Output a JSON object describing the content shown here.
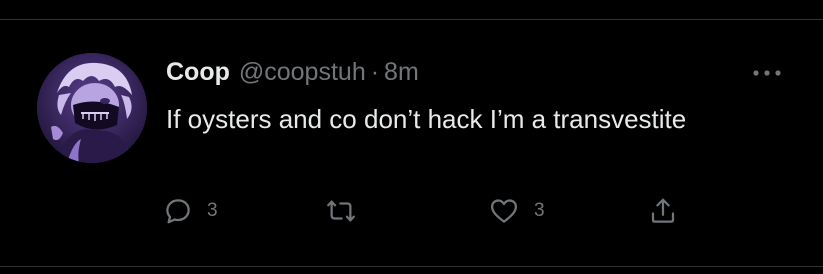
{
  "tweet": {
    "author": {
      "display_name": "Coop",
      "handle": "@coopstuh",
      "avatar_icon": "avatar-image"
    },
    "separator": "·",
    "time": "8m",
    "text": "If oysters and co don’t hack I’m a transvestite",
    "actions": {
      "reply": {
        "icon": "reply-icon",
        "count": "3"
      },
      "retweet": {
        "icon": "retweet-icon"
      },
      "like": {
        "icon": "heart-icon",
        "count": "3"
      },
      "share": {
        "icon": "share-icon"
      }
    },
    "more_icon": "more-options-icon"
  },
  "colors": {
    "background": "#000000",
    "primary_text": "#e7e9ea",
    "secondary_text": "#71767b",
    "divider": "#2f3336"
  }
}
